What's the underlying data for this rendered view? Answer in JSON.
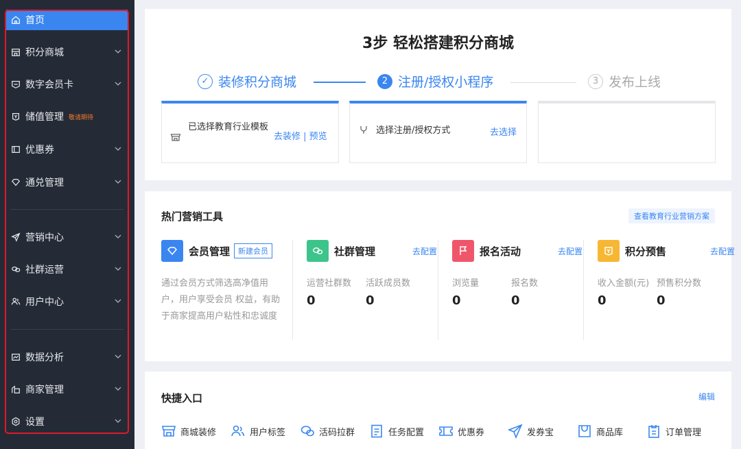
{
  "sidebar": {
    "items": [
      {
        "label": "首页",
        "icon": "home-icon",
        "active": true
      },
      {
        "label": "积分商城",
        "icon": "store-icon"
      },
      {
        "label": "数字会员卡",
        "icon": "card-icon"
      },
      {
        "label": "储值管理",
        "icon": "wallet-icon",
        "tag": "敬请期待"
      },
      {
        "label": "优惠券",
        "icon": "coupon-icon"
      },
      {
        "label": "通兑管理",
        "icon": "diamond-icon"
      },
      {
        "label": "营销中心",
        "icon": "send-icon"
      },
      {
        "label": "社群运营",
        "icon": "chat-icon"
      },
      {
        "label": "用户中心",
        "icon": "users-icon"
      },
      {
        "label": "数据分析",
        "icon": "chart-icon"
      },
      {
        "label": "商家管理",
        "icon": "shop-icon"
      },
      {
        "label": "设置",
        "icon": "settings-icon"
      }
    ]
  },
  "steps": {
    "title": "3步 轻松搭建积分商城",
    "items": [
      {
        "num": "✓",
        "label": "装修积分商城"
      },
      {
        "num": "2",
        "label": "注册/授权小程序"
      },
      {
        "num": "3",
        "label": "发布上线"
      }
    ],
    "boxes": [
      {
        "text": "已选择教育行业模板",
        "link": "去装修 | 预览"
      },
      {
        "text": "选择注册/授权方式",
        "link": "去选择"
      },
      {
        "text": "",
        "link": ""
      }
    ]
  },
  "tools": {
    "title": "热门营销工具",
    "plan_link": "查看教育行业营销方案",
    "member": {
      "name": "会员管理",
      "button": "新建会员",
      "desc": "通过会员方式筛选高净值用户，用户享受会员 权益，有助于商家提高用户粘性和忠诚度"
    },
    "group": {
      "name": "社群管理",
      "link": "去配置",
      "stats": [
        {
          "label": "运营社群数",
          "value": "0"
        },
        {
          "label": "活跃成员数",
          "value": "0"
        }
      ]
    },
    "signup": {
      "name": "报名活动",
      "link": "去配置",
      "stats": [
        {
          "label": "浏览量",
          "value": "0"
        },
        {
          "label": "报名数",
          "value": "0"
        }
      ]
    },
    "presale": {
      "name": "积分预售",
      "link": "去配置",
      "stats": [
        {
          "label": "收入金额(元)",
          "value": "0"
        },
        {
          "label": "预售积分数",
          "value": "0"
        }
      ]
    }
  },
  "quick": {
    "title": "快捷入口",
    "edit": "编辑",
    "items": [
      {
        "label": "商城装修",
        "icon": "storefront-icon"
      },
      {
        "label": "用户标签",
        "icon": "user-tag-icon"
      },
      {
        "label": "活码拉群",
        "icon": "wechat-icon"
      },
      {
        "label": "任务配置",
        "icon": "task-icon"
      },
      {
        "label": "优惠券",
        "icon": "coupon-icon"
      },
      {
        "label": "发券宝",
        "icon": "send-icon"
      },
      {
        "label": "商品库",
        "icon": "goods-icon"
      },
      {
        "label": "订单管理",
        "icon": "order-icon"
      }
    ]
  },
  "colors": {
    "accent": "#3a86f0",
    "sidebar_bg": "#252b36",
    "highlight_frame": "#e0192b"
  }
}
